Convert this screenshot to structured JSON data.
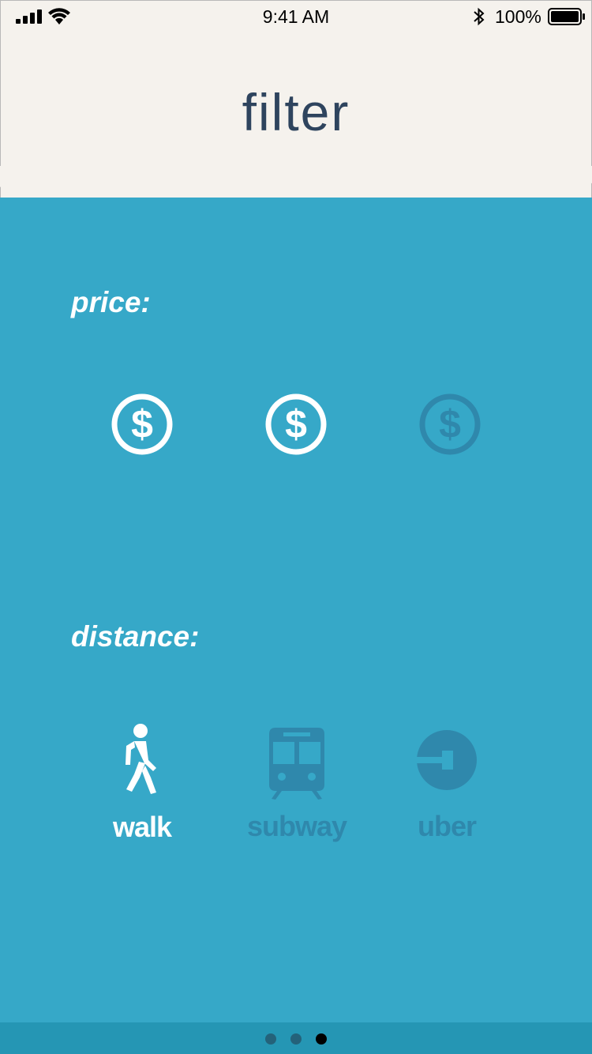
{
  "status_bar": {
    "time": "9:41 AM",
    "battery_percent": "100%",
    "icons": [
      "signal-icon",
      "wifi-icon",
      "bluetooth-icon",
      "battery-icon"
    ]
  },
  "header": {
    "title": "filter"
  },
  "price": {
    "label": "price:",
    "options": [
      {
        "icon": "dollar-icon",
        "selected": true
      },
      {
        "icon": "dollar-icon",
        "selected": true
      },
      {
        "icon": "dollar-icon",
        "selected": false
      }
    ]
  },
  "distance": {
    "label": "distance:",
    "options": [
      {
        "label": "walk",
        "icon": "walk-icon",
        "selected": true
      },
      {
        "label": "subway",
        "icon": "subway-icon",
        "selected": false
      },
      {
        "label": "uber",
        "icon": "uber-icon",
        "selected": false
      }
    ]
  },
  "pager": {
    "total": 3,
    "current": 3
  },
  "colors": {
    "background": "#36a8c8",
    "header_bg": "#f5f2ed",
    "title": "#2e445e",
    "active": "#ffffff",
    "inactive": "#2d7ea3",
    "footer": "#2596b4",
    "dot_inactive": "#24627a",
    "dot_active": "#000000"
  }
}
